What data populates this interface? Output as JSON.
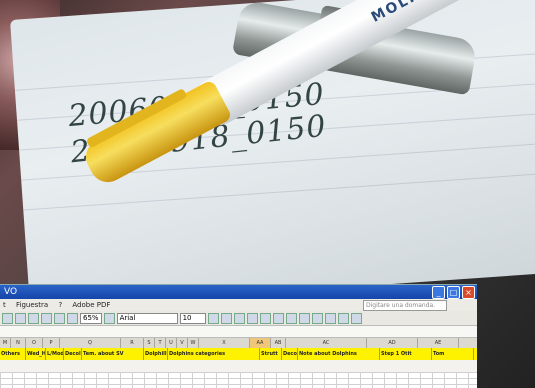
{
  "handwriting": {
    "line1": "20060918_0150",
    "line2": "20060918_0150"
  },
  "pen": {
    "print": "MOLINEORO"
  },
  "excel": {
    "title": "VO",
    "menu": [
      "t",
      "Figuestra",
      "?",
      "Adobe PDF"
    ],
    "help_placeholder": "Digitare una domanda.",
    "zoom": "65%",
    "font": "Arial",
    "font_size": "10",
    "col_headers": [
      "M",
      "N",
      "O",
      "P",
      "Q",
      "R",
      "S",
      "T",
      "U",
      "V",
      "W",
      "X",
      "AA",
      "AB",
      "AC",
      "AD",
      "AE"
    ],
    "header_cells": [
      "Others",
      "Wed_HFS",
      "L/Mod",
      "Decoll",
      "Tem. about SV",
      "Dolphill",
      "Dolphins categories",
      "Strutt",
      "Decoll",
      "Note about Dolphins",
      "Step 1 Otit",
      "Tom"
    ]
  },
  "colors": {
    "title_bar": "#2b63c9",
    "header_yellow": "#fff200",
    "pen_cap": "#f2c320"
  }
}
